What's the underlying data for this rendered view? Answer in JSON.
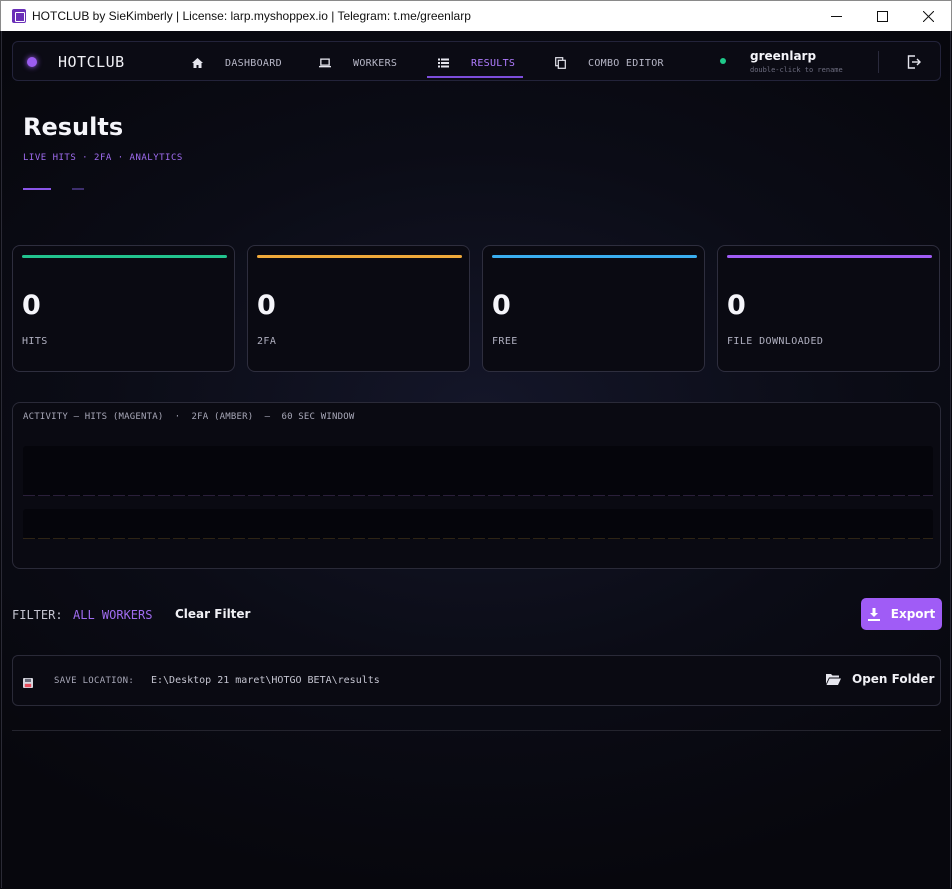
{
  "window": {
    "title": "HOTCLUB by SieKimberly | License: larp.myshoppex.io | Telegram: t.me/greenlarp"
  },
  "nav": {
    "brand": "HOTCLUB",
    "items": [
      {
        "label": "DASHBOARD",
        "icon": "home-icon"
      },
      {
        "label": "WORKERS",
        "icon": "laptop-icon"
      },
      {
        "label": "RESULTS",
        "icon": "list-icon"
      },
      {
        "label": "COMBO EDITOR",
        "icon": "copy-icon"
      }
    ],
    "active": "RESULTS",
    "user": {
      "name": "greenlarp",
      "hint": "double-click to rename",
      "status_color": "#1fc98a"
    }
  },
  "header": {
    "title": "Results",
    "subtitle": "LIVE HITS · 2FA · ANALYTICS"
  },
  "stats": [
    {
      "value": "0",
      "label": "HITS",
      "color": "#22c38e"
    },
    {
      "value": "0",
      "label": "2FA",
      "color": "#f0a93a"
    },
    {
      "value": "0",
      "label": "FREE",
      "color": "#3aaef0"
    },
    {
      "value": "0",
      "label": "FILE DOWNLOADED",
      "color": "#a05cf6"
    }
  ],
  "activity": {
    "label": "ACTIVITY — HITS (MAGENTA)  ·  2FA (AMBER)  —  60 SEC WINDOW"
  },
  "filter": {
    "label": "FILTER:",
    "value": "ALL WORKERS",
    "clear_label": "Clear Filter",
    "export_label": "Export"
  },
  "save": {
    "label": "SAVE LOCATION:",
    "path": "E:\\Desktop 21 maret\\HOTGO BETA\\results",
    "open_label": "Open Folder"
  },
  "colors": {
    "accent": "#a05cf6",
    "background": "#07070d"
  }
}
